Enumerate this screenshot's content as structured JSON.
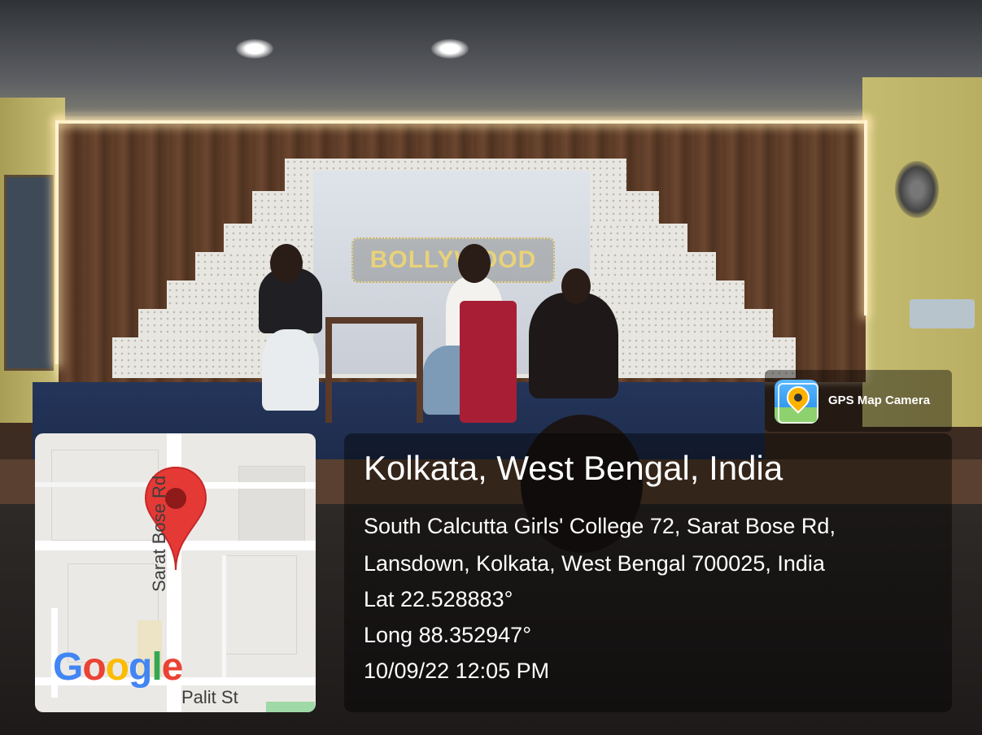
{
  "app": {
    "name": "GPS Map Camera",
    "icon": "gps-map-camera-icon"
  },
  "scene": {
    "banner_text": "BOLLYWOOD"
  },
  "map": {
    "road_labels": [
      "Sarat Bose Rd",
      "Palit St"
    ],
    "provider_logo": "Google",
    "pin_color": "#e53935"
  },
  "location": {
    "title": "Kolkata, West Bengal, India",
    "address_line1": "South Calcutta Girls' College 72, Sarat Bose Rd,",
    "address_line2": "Lansdown, Kolkata, West Bengal 700025, India",
    "lat": "Lat 22.528883°",
    "long": "Long 88.352947°",
    "datetime": "10/09/22 12:05 PM"
  }
}
